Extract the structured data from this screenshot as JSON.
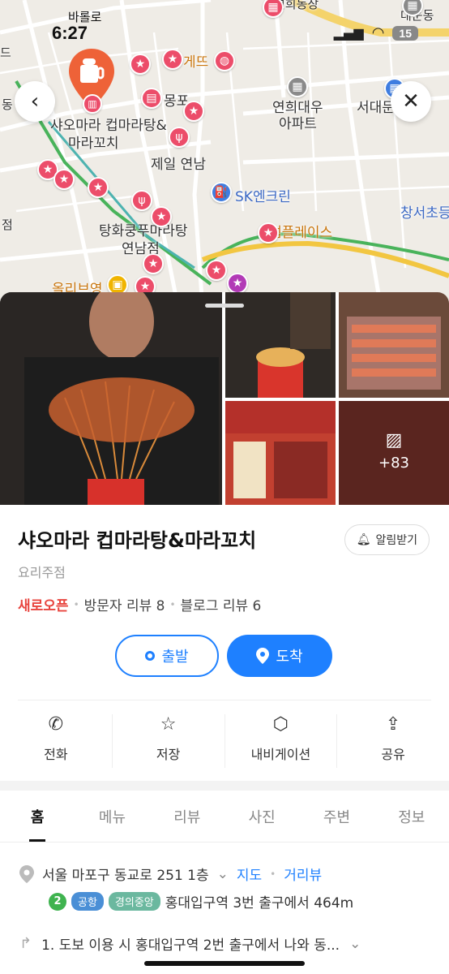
{
  "status": {
    "time": "6:27",
    "back_app": "바롤로",
    "battery": "15"
  },
  "map": {
    "labels": {
      "selected_place_1": "샤오마라 컵마라탕&",
      "selected_place_2": "마라꼬치",
      "mokpo": "몽포",
      "jeil": "제일 연남",
      "tanghwa_1": "탕화쿵푸마라탕",
      "tanghwa_2": "연남점",
      "sk": "SK엔크린",
      "yeonhui_apt_1": "연희대우",
      "yeonhui_apt_2": "아파트",
      "seodaemun": "서대문",
      "changseo": "창서초등",
      "daewoon": "대운동",
      "yeonhuidong": "연희동장",
      "gate": "게뜨",
      "ssom": "썸플레이스",
      "oliveyoung": "올리브영",
      "dong": "동",
      "jeom": "점",
      "top_left": "드"
    }
  },
  "sheet": {
    "title": "샤오마라 컵마라탕&마라꼬치",
    "category": "요리주점",
    "new_open": "새로오픈",
    "visitor_reviews": "방문자 리뷰 8",
    "blog_reviews": "블로그 리뷰 6",
    "alarm_label": "알림받기",
    "photo_more": "+83",
    "start_label": "출발",
    "arrive_label": "도착",
    "actions": [
      {
        "label": "전화",
        "icon": "phone-icon"
      },
      {
        "label": "저장",
        "icon": "star-icon"
      },
      {
        "label": "내비게이션",
        "icon": "navigation-icon"
      },
      {
        "label": "공유",
        "icon": "share-icon"
      }
    ],
    "tabs": [
      "홈",
      "메뉴",
      "리뷰",
      "사진",
      "주변",
      "정보"
    ],
    "address": "서울 마포구 동교로 251 1층",
    "map_link": "지도",
    "street_link": "거리뷰",
    "subway": {
      "line_num": "2",
      "airport": "공항",
      "gyeongui": "경의중앙",
      "text": "홍대입구역 3번 출구에서 464m"
    },
    "route": "1. 도보 이용 시 홍대입구역 2번 출구에서 나와 동..."
  }
}
